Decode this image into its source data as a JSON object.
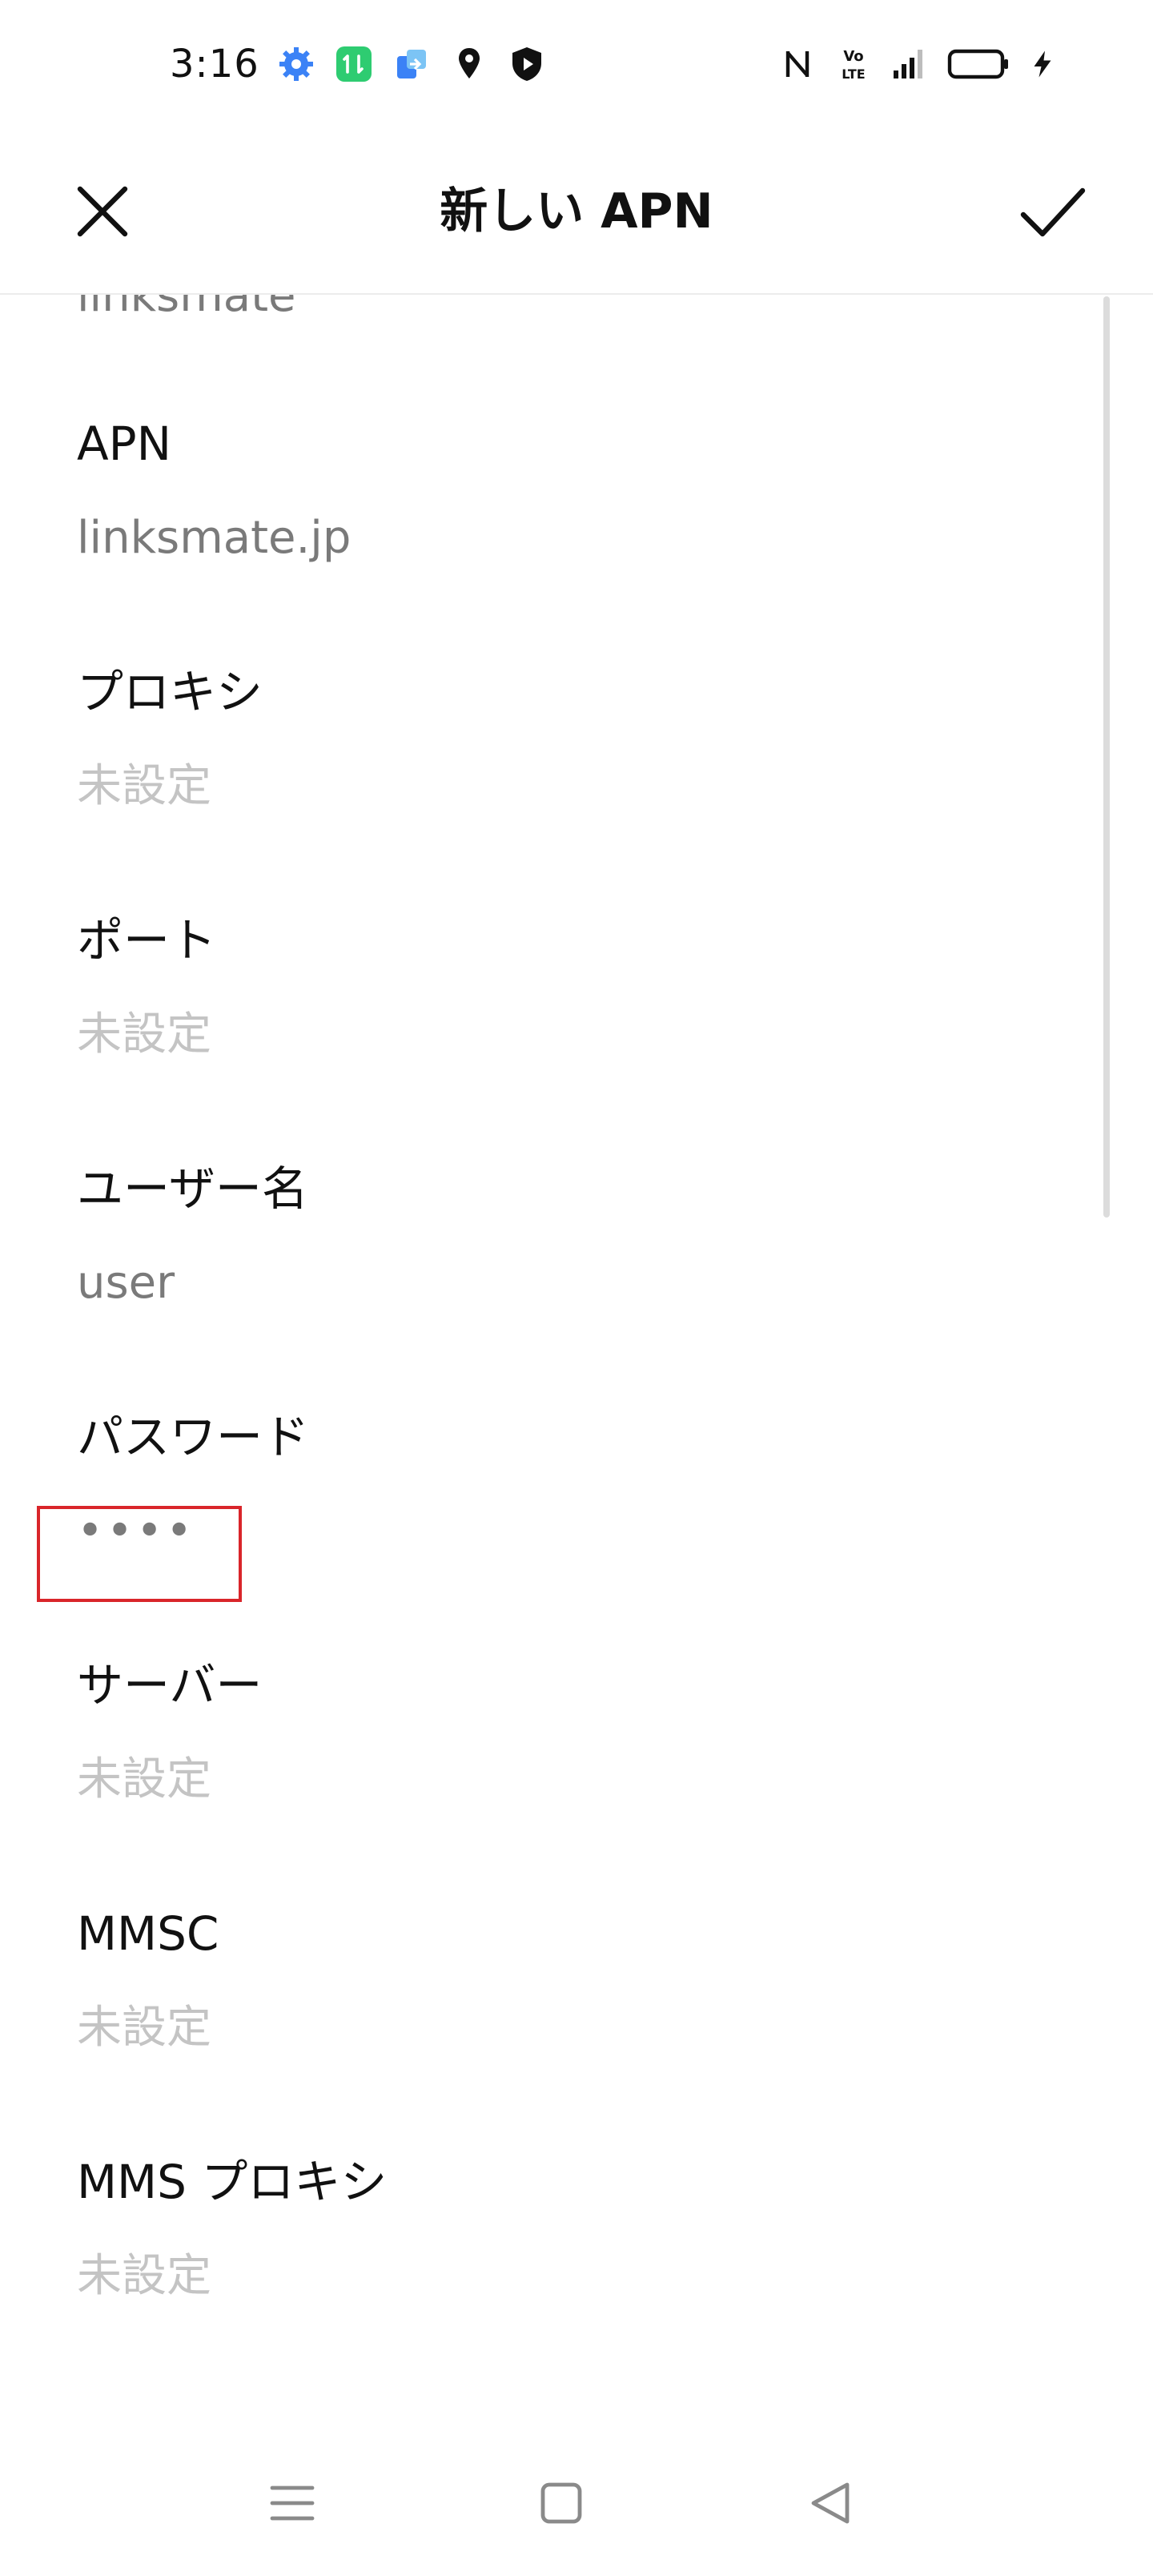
{
  "status_bar": {
    "time": "3:16",
    "icons_left": [
      "gear-icon",
      "app-badge-icon",
      "transfer-icon",
      "location-icon",
      "shield-icon"
    ],
    "icons_right": [
      "nfc-icon",
      "volte-icon",
      "signal-icon",
      "battery-icon",
      "charging-icon"
    ],
    "volte_top": "Vo",
    "volte_bottom": "LTE"
  },
  "app_bar": {
    "title": "新しい APN",
    "close_icon": "close-icon",
    "confirm_icon": "check-icon"
  },
  "list": {
    "partial_value": "linksmate",
    "fields": [
      {
        "label": "APN",
        "value": "linksmate.jp",
        "state": "set"
      },
      {
        "label": "プロキシ",
        "value": "未設定",
        "state": "unset"
      },
      {
        "label": "ポート",
        "value": "未設定",
        "state": "unset"
      },
      {
        "label": "ユーザー名",
        "value": "user",
        "state": "set"
      },
      {
        "label": "パスワード",
        "value": "••••",
        "state": "password"
      },
      {
        "label": "サーバー",
        "value": "未設定",
        "state": "unset"
      },
      {
        "label": "MMSC",
        "value": "未設定",
        "state": "unset"
      },
      {
        "label": "MMS プロキシ",
        "value": "未設定",
        "state": "unset"
      }
    ]
  },
  "nav_bar": {
    "buttons": [
      "menu-icon",
      "home-icon",
      "back-icon"
    ]
  },
  "colors": {
    "highlight": "#d9252a",
    "value_text": "#7a7a7a",
    "unset_text": "#c4c4c4",
    "accent_blue": "#3b82f6",
    "badge_green": "#2ecc71"
  }
}
